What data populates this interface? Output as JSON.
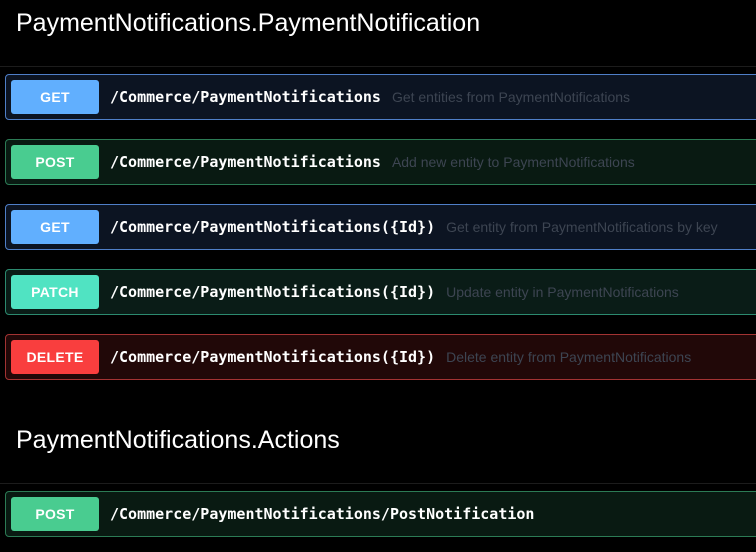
{
  "sections": [
    {
      "title": "PaymentNotifications.PaymentNotification",
      "operations": [
        {
          "method": "GET",
          "path": "/Commerce/PaymentNotifications",
          "summary": "Get entities from PaymentNotifications"
        },
        {
          "method": "POST",
          "path": "/Commerce/PaymentNotifications",
          "summary": "Add new entity to PaymentNotifications"
        },
        {
          "method": "GET",
          "path": "/Commerce/PaymentNotifications({Id})",
          "summary": "Get entity from PaymentNotifications by key"
        },
        {
          "method": "PATCH",
          "path": "/Commerce/PaymentNotifications({Id})",
          "summary": "Update entity in PaymentNotifications"
        },
        {
          "method": "DELETE",
          "path": "/Commerce/PaymentNotifications({Id})",
          "summary": "Delete entity from PaymentNotifications"
        }
      ]
    },
    {
      "title": "PaymentNotifications.Actions",
      "operations": [
        {
          "method": "POST",
          "path": "/Commerce/PaymentNotifications/PostNotification",
          "summary": ""
        }
      ]
    }
  ],
  "colors": {
    "get": "#61affe",
    "post": "#49cc90",
    "patch": "#50e3c2",
    "delete": "#f93e3e",
    "background": "#000000"
  }
}
